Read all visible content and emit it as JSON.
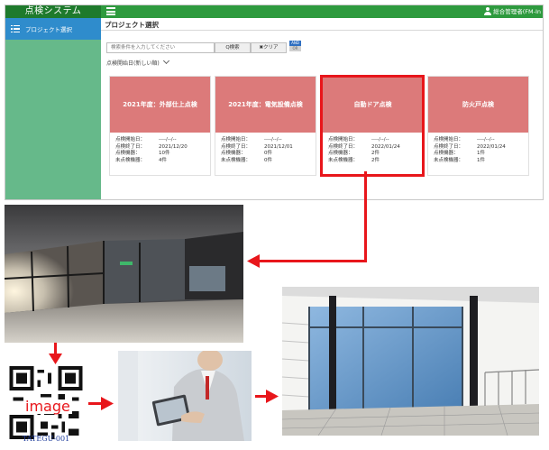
{
  "app": {
    "brand": "点検システム",
    "user_name": "総合管理者(FM-In",
    "sidebar": {
      "item_label": "プロジェクト選択"
    },
    "page_title": "プロジェクト選択",
    "search": {
      "placeholder": "検索条件を入力してください",
      "search_button": "Q検索",
      "clear_button": "✖クリア",
      "and_label": "AND",
      "or_label": "OR"
    },
    "sort_label": "点検開始日(新しい順)",
    "field_labels": {
      "start": "点検開始日：",
      "end": "点検終了日：",
      "inspected": "点検機器：",
      "uninspected": "未点検機器："
    },
    "cards": [
      {
        "title": "2021年度：外部仕上点検",
        "start": "----/--/--",
        "end": "2021/12/20",
        "inspected": "10件",
        "uninspected": "4件"
      },
      {
        "title": "2021年度：電気設備点検",
        "start": "----/--/--",
        "end": "2021/12/01",
        "inspected": "0件",
        "uninspected": "0件"
      },
      {
        "title": "自動ドア点検",
        "start": "----/--/--",
        "end": "2022/01/24",
        "inspected": "2件",
        "uninspected": "2件"
      },
      {
        "title": "防火戸点検",
        "start": "----/--/--",
        "end": "2022/01/24",
        "inspected": "1件",
        "uninspected": "1件"
      }
    ],
    "colors": {
      "topbar": "#2e9a3e",
      "sidebar": "#66b98a",
      "sidebar_active": "#2f8ccc",
      "card_header": "#dc7a7a",
      "highlight": "#e8161b"
    }
  },
  "figure": {
    "qr_overlay_text": "image",
    "qr_label": "TATEGU-001",
    "arrow_color": "#e8161b"
  }
}
